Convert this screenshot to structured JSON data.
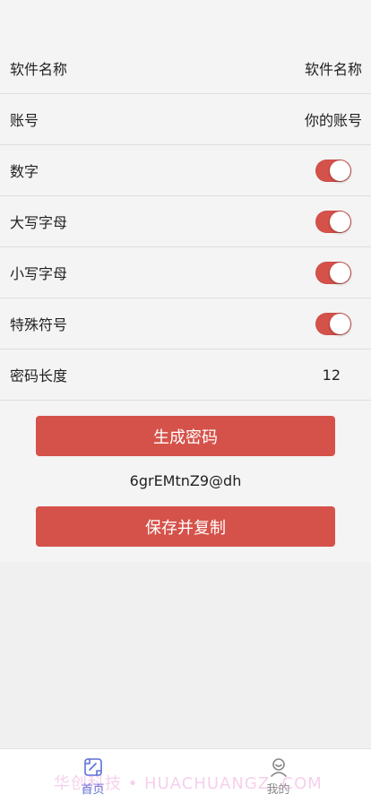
{
  "form": {
    "app_name": {
      "label": "软件名称",
      "value": "软件名称"
    },
    "account": {
      "label": "账号",
      "value": "你的账号"
    },
    "toggles": [
      {
        "label": "数字",
        "on": true
      },
      {
        "label": "大写字母",
        "on": true
      },
      {
        "label": "小写字母",
        "on": true
      },
      {
        "label": "特殊符号",
        "on": true
      }
    ],
    "length": {
      "label": "密码长度",
      "value": "12"
    }
  },
  "actions": {
    "generate_label": "生成密码",
    "password": "6grEMtnZ9@dh",
    "save_copy_label": "保存并复制"
  },
  "tabbar": {
    "home_label": "首页",
    "mine_label": "我的"
  },
  "watermark": "华创科技 • HUACHUANGZ .COM",
  "colors": {
    "accent": "#d5524a",
    "tab_active": "#5b6fd6",
    "tab_inactive": "#888888"
  },
  "icons": {
    "home": "home-page-icon",
    "mine": "user-icon"
  }
}
